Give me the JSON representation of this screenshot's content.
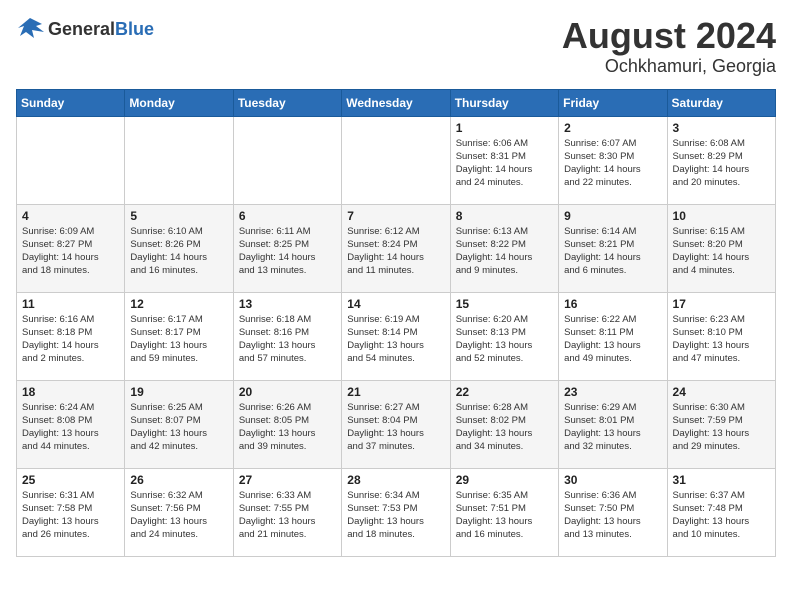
{
  "logo": {
    "general": "General",
    "blue": "Blue"
  },
  "title": {
    "month_year": "August 2024",
    "location": "Ochkhamuri, Georgia"
  },
  "calendar": {
    "headers": [
      "Sunday",
      "Monday",
      "Tuesday",
      "Wednesday",
      "Thursday",
      "Friday",
      "Saturday"
    ],
    "weeks": [
      [
        {
          "day": "",
          "info": ""
        },
        {
          "day": "",
          "info": ""
        },
        {
          "day": "",
          "info": ""
        },
        {
          "day": "",
          "info": ""
        },
        {
          "day": "1",
          "info": "Sunrise: 6:06 AM\nSunset: 8:31 PM\nDaylight: 14 hours\nand 24 minutes."
        },
        {
          "day": "2",
          "info": "Sunrise: 6:07 AM\nSunset: 8:30 PM\nDaylight: 14 hours\nand 22 minutes."
        },
        {
          "day": "3",
          "info": "Sunrise: 6:08 AM\nSunset: 8:29 PM\nDaylight: 14 hours\nand 20 minutes."
        }
      ],
      [
        {
          "day": "4",
          "info": "Sunrise: 6:09 AM\nSunset: 8:27 PM\nDaylight: 14 hours\nand 18 minutes."
        },
        {
          "day": "5",
          "info": "Sunrise: 6:10 AM\nSunset: 8:26 PM\nDaylight: 14 hours\nand 16 minutes."
        },
        {
          "day": "6",
          "info": "Sunrise: 6:11 AM\nSunset: 8:25 PM\nDaylight: 14 hours\nand 13 minutes."
        },
        {
          "day": "7",
          "info": "Sunrise: 6:12 AM\nSunset: 8:24 PM\nDaylight: 14 hours\nand 11 minutes."
        },
        {
          "day": "8",
          "info": "Sunrise: 6:13 AM\nSunset: 8:22 PM\nDaylight: 14 hours\nand 9 minutes."
        },
        {
          "day": "9",
          "info": "Sunrise: 6:14 AM\nSunset: 8:21 PM\nDaylight: 14 hours\nand 6 minutes."
        },
        {
          "day": "10",
          "info": "Sunrise: 6:15 AM\nSunset: 8:20 PM\nDaylight: 14 hours\nand 4 minutes."
        }
      ],
      [
        {
          "day": "11",
          "info": "Sunrise: 6:16 AM\nSunset: 8:18 PM\nDaylight: 14 hours\nand 2 minutes."
        },
        {
          "day": "12",
          "info": "Sunrise: 6:17 AM\nSunset: 8:17 PM\nDaylight: 13 hours\nand 59 minutes."
        },
        {
          "day": "13",
          "info": "Sunrise: 6:18 AM\nSunset: 8:16 PM\nDaylight: 13 hours\nand 57 minutes."
        },
        {
          "day": "14",
          "info": "Sunrise: 6:19 AM\nSunset: 8:14 PM\nDaylight: 13 hours\nand 54 minutes."
        },
        {
          "day": "15",
          "info": "Sunrise: 6:20 AM\nSunset: 8:13 PM\nDaylight: 13 hours\nand 52 minutes."
        },
        {
          "day": "16",
          "info": "Sunrise: 6:22 AM\nSunset: 8:11 PM\nDaylight: 13 hours\nand 49 minutes."
        },
        {
          "day": "17",
          "info": "Sunrise: 6:23 AM\nSunset: 8:10 PM\nDaylight: 13 hours\nand 47 minutes."
        }
      ],
      [
        {
          "day": "18",
          "info": "Sunrise: 6:24 AM\nSunset: 8:08 PM\nDaylight: 13 hours\nand 44 minutes."
        },
        {
          "day": "19",
          "info": "Sunrise: 6:25 AM\nSunset: 8:07 PM\nDaylight: 13 hours\nand 42 minutes."
        },
        {
          "day": "20",
          "info": "Sunrise: 6:26 AM\nSunset: 8:05 PM\nDaylight: 13 hours\nand 39 minutes."
        },
        {
          "day": "21",
          "info": "Sunrise: 6:27 AM\nSunset: 8:04 PM\nDaylight: 13 hours\nand 37 minutes."
        },
        {
          "day": "22",
          "info": "Sunrise: 6:28 AM\nSunset: 8:02 PM\nDaylight: 13 hours\nand 34 minutes."
        },
        {
          "day": "23",
          "info": "Sunrise: 6:29 AM\nSunset: 8:01 PM\nDaylight: 13 hours\nand 32 minutes."
        },
        {
          "day": "24",
          "info": "Sunrise: 6:30 AM\nSunset: 7:59 PM\nDaylight: 13 hours\nand 29 minutes."
        }
      ],
      [
        {
          "day": "25",
          "info": "Sunrise: 6:31 AM\nSunset: 7:58 PM\nDaylight: 13 hours\nand 26 minutes."
        },
        {
          "day": "26",
          "info": "Sunrise: 6:32 AM\nSunset: 7:56 PM\nDaylight: 13 hours\nand 24 minutes."
        },
        {
          "day": "27",
          "info": "Sunrise: 6:33 AM\nSunset: 7:55 PM\nDaylight: 13 hours\nand 21 minutes."
        },
        {
          "day": "28",
          "info": "Sunrise: 6:34 AM\nSunset: 7:53 PM\nDaylight: 13 hours\nand 18 minutes."
        },
        {
          "day": "29",
          "info": "Sunrise: 6:35 AM\nSunset: 7:51 PM\nDaylight: 13 hours\nand 16 minutes."
        },
        {
          "day": "30",
          "info": "Sunrise: 6:36 AM\nSunset: 7:50 PM\nDaylight: 13 hours\nand 13 minutes."
        },
        {
          "day": "31",
          "info": "Sunrise: 6:37 AM\nSunset: 7:48 PM\nDaylight: 13 hours\nand 10 minutes."
        }
      ]
    ]
  }
}
